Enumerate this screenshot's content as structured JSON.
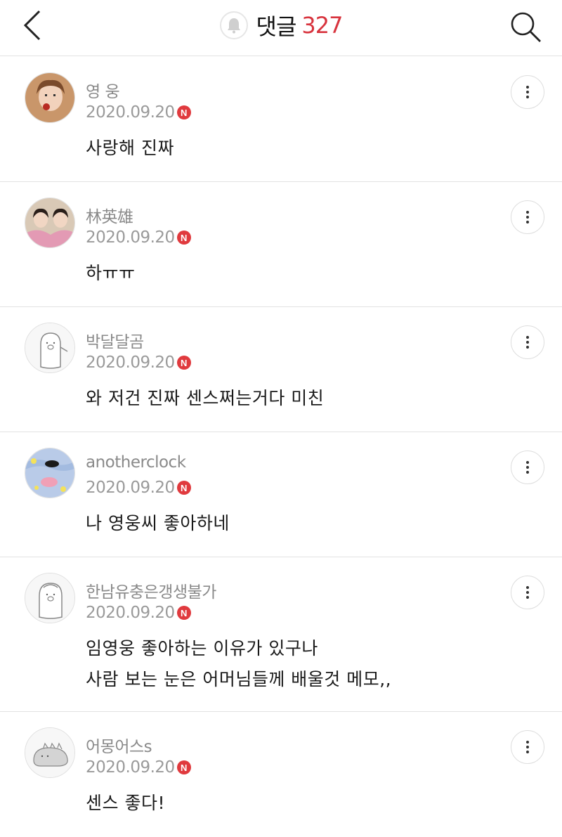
{
  "header": {
    "title": "댓글",
    "count": "327",
    "back_icon": "chevron-left-icon",
    "bell_icon": "bell-icon",
    "search_icon": "search-icon"
  },
  "colors": {
    "accent": "#d8343e",
    "new_badge": "#e03a3e"
  },
  "comments": [
    {
      "author": "영 웅",
      "date": "2020.09.20",
      "badge": "N",
      "text": "사랑해 진짜"
    },
    {
      "author": "林英雄",
      "date": "2020.09.20",
      "badge": "N",
      "text": "하ㅠㅠ"
    },
    {
      "author": "박달달곰",
      "date": "2020.09.20",
      "badge": "N",
      "text": "와 저건 진짜 센스쩌는거다 미친"
    },
    {
      "author": "anotherclock",
      "date": "2020.09.20",
      "badge": "N",
      "text": "나 영웅씨 좋아하네"
    },
    {
      "author": "한남유충은갱생불가",
      "date": "2020.09.20",
      "badge": "N",
      "text": "임영웅 좋아하는 이유가 있구나",
      "text2": "사람 보는 눈은 어머님들께 배울것 메모,,"
    },
    {
      "author": "어몽어스s",
      "date": "2020.09.20",
      "badge": "N",
      "text": "센스 좋다!"
    }
  ]
}
